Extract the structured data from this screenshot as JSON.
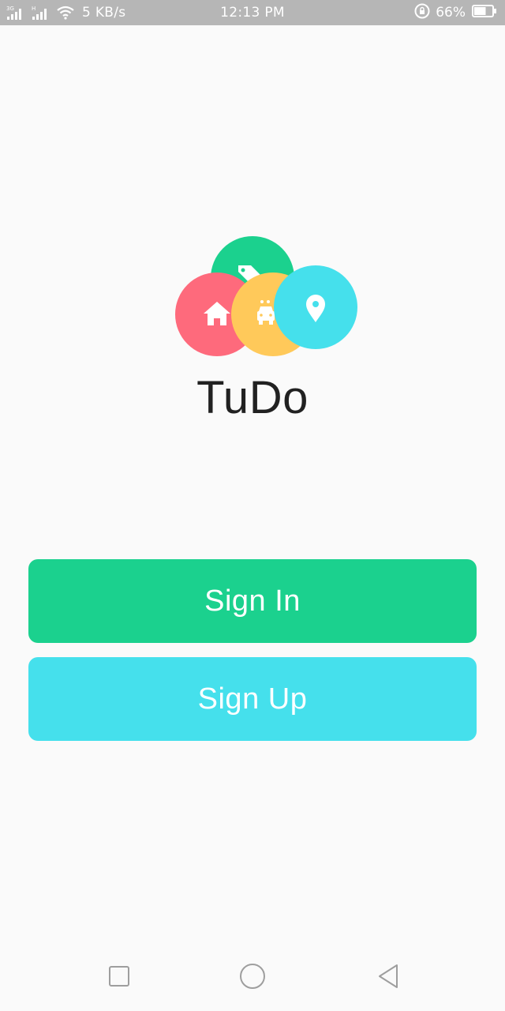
{
  "status_bar": {
    "network_speed": "5 KB/s",
    "time": "12:13 PM",
    "battery_percent": "66%",
    "battery_level": 0.66,
    "icons": [
      "signal-3g-icon",
      "signal-h-icon",
      "wifi-icon",
      "rotation-lock-icon",
      "battery-icon"
    ]
  },
  "logo": {
    "circles": [
      {
        "name": "tag",
        "color": "#1bd18e",
        "icon": "tag-icon"
      },
      {
        "name": "home",
        "color": "#fe6a7c",
        "icon": "home-icon"
      },
      {
        "name": "carwash",
        "color": "#ffc95a",
        "icon": "car-wash-icon"
      },
      {
        "name": "location",
        "color": "#45e0ec",
        "icon": "location-pin-icon"
      }
    ]
  },
  "app": {
    "title": "TuDo"
  },
  "buttons": {
    "sign_in": "Sign In",
    "sign_up": "Sign Up",
    "sign_in_color": "#1bd18e",
    "sign_up_color": "#45e0ec"
  },
  "nav_bar": {
    "icons": [
      "recent-apps-icon",
      "home-nav-icon",
      "back-icon"
    ]
  }
}
